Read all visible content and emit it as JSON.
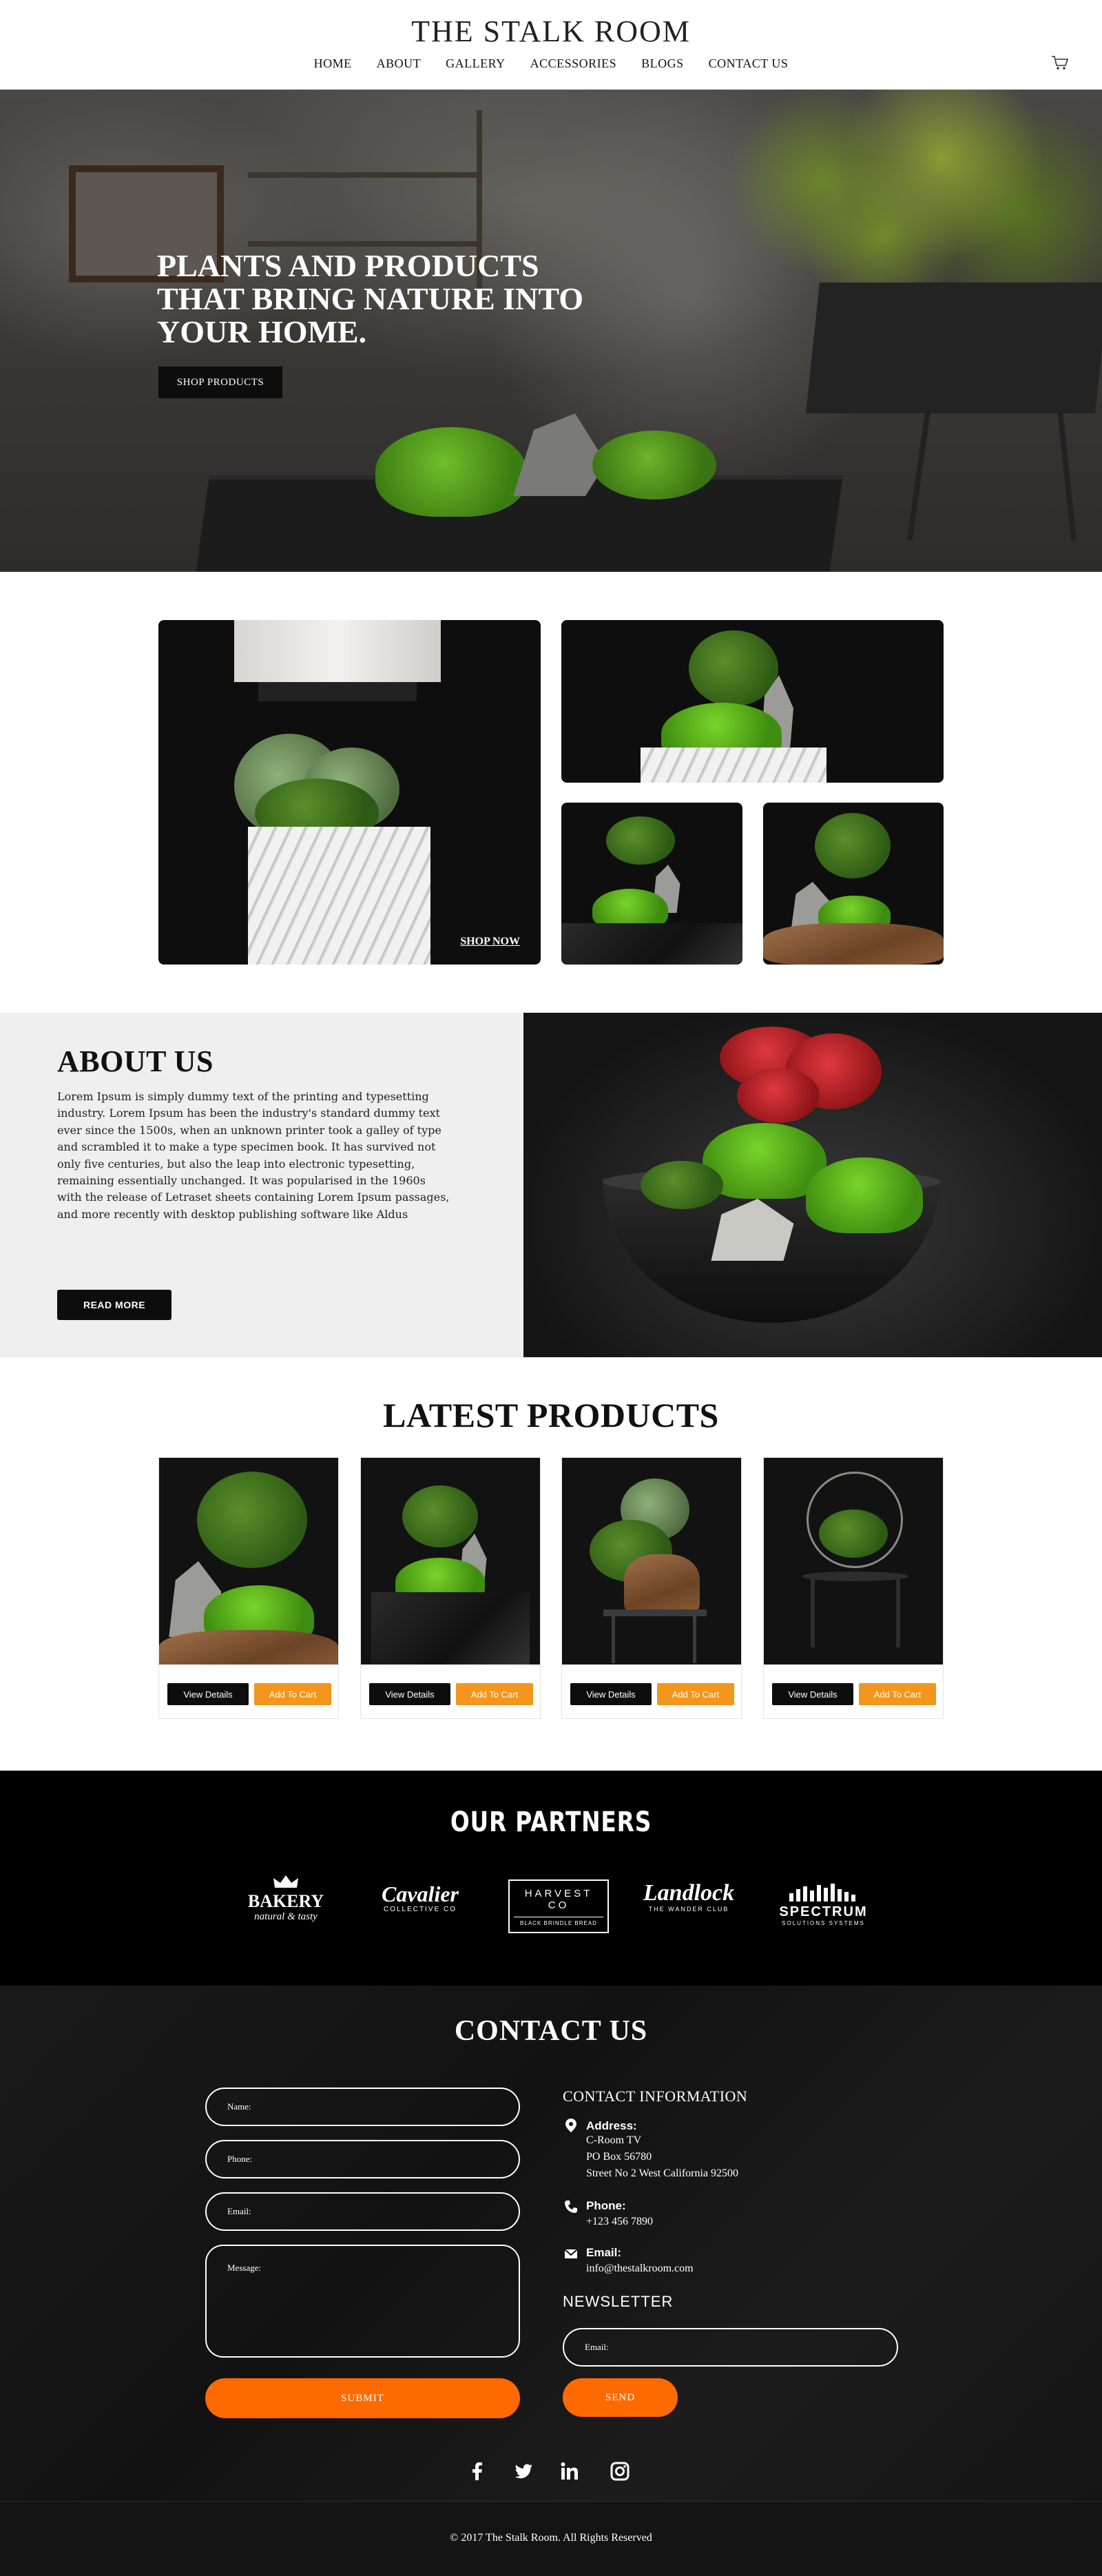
{
  "header": {
    "logo": "THE STALK ROOM",
    "nav": [
      "HOME",
      "ABOUT",
      "GALLERY",
      "ACCESSORIES",
      "BLOGS",
      "CONTACT US"
    ],
    "cart_icon": "cart-icon"
  },
  "hero": {
    "title": "PLANTS AND PRODUCTS THAT BRING NATURE INTO YOUR HOME.",
    "button": "SHOP PRODUCTS"
  },
  "gallery": {
    "shop_now": "SHOP NOW"
  },
  "about": {
    "title": "ABOUT US",
    "text": "Lorem Ipsum is simply dummy text of the printing and typesetting industry. Lorem Ipsum has been the industry's standard dummy text ever since the 1500s, when an unknown printer took a galley of type and scrambled it to make a type specimen book. It has survived not only five centuries, but also the leap into electronic typesetting, remaining essentially unchanged. It was popularised in the 1960s with the release of Letraset sheets containing Lorem Ipsum passages, and more recently with desktop publishing software like Aldus",
    "button": "READ MORE"
  },
  "latest": {
    "title": "LATEST PRODUCTS",
    "view_label": "View Details",
    "cart_label": "Add To Cart"
  },
  "partners": {
    "title": "OUR PARTNERS",
    "logos": [
      {
        "name": "BAKERY",
        "sub": "natural & tasty"
      },
      {
        "name": "Cavalier",
        "sub": "COLLECTIVE CO"
      },
      {
        "name": "HARVEST CO",
        "sub": "BLACK BRINDLE BREAD"
      },
      {
        "name": "Landlock",
        "sub": "THE WANDER CLUB"
      },
      {
        "name": "SPECTRUM",
        "sub": "SOLUTIONS SYSTEMS"
      }
    ]
  },
  "contact": {
    "title": "CONTACT US",
    "form": {
      "name_placeholder": "Name:",
      "phone_placeholder": "Phone:",
      "email_placeholder": "Email:",
      "message_placeholder": "Message:",
      "submit": "SUBMIT"
    },
    "info": {
      "title": "CONTACT INFORMATION",
      "address_label": "Address:",
      "address_lines": [
        "C-Room TV",
        "PO Box 56780",
        "Street No 2 West California 92500"
      ],
      "phone_label": "Phone:",
      "phone": "+123 456 7890",
      "email_label": "Email:",
      "email": "info@thestalkroom.com"
    },
    "newsletter": {
      "title": "NEWSLETTER",
      "email_placeholder": "Email:",
      "send": "SEND"
    },
    "social": [
      "facebook-icon",
      "twitter-icon",
      "linkedin-icon",
      "instagram-icon"
    ]
  },
  "footer": {
    "copyright": "© 2017 The Stalk Room. All Rights Reserved"
  },
  "colors": {
    "accent_orange": "#ff6a00",
    "cart_orange": "#f2961e",
    "dark": "#0d0d0d"
  }
}
